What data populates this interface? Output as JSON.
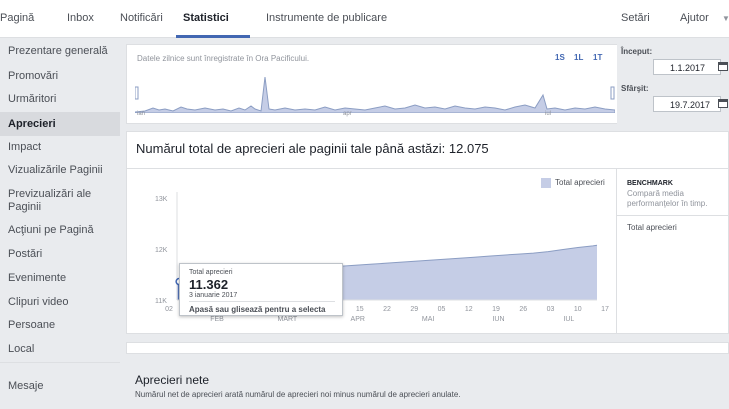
{
  "topnav": {
    "tabs": [
      "Pagină",
      "Inbox",
      "Notificări",
      "Statistici",
      "Instrumente de publicare",
      "Setări",
      "Ajutor"
    ],
    "active_tab": "Statistici"
  },
  "sidebar": {
    "items": [
      {
        "label": "Prezentare generală"
      },
      {
        "label": "Promovări"
      },
      {
        "label": "Urmăritori"
      },
      {
        "label": "Aprecieri"
      },
      {
        "label": "Impact"
      },
      {
        "label": "Vizualizările Paginii"
      },
      {
        "label": "Previzualizări ale Paginii"
      },
      {
        "label": "Acţiuni pe Pagină"
      },
      {
        "label": "Postări"
      },
      {
        "label": "Evenimente"
      },
      {
        "label": "Clipuri video"
      },
      {
        "label": "Persoane"
      },
      {
        "label": "Local"
      },
      {
        "label": "Mesaje"
      }
    ],
    "active": "Aprecieri"
  },
  "timeline": {
    "note": "Datele zilnice sunt înregistrate în Ora Pacificului.",
    "ranges": [
      "1S",
      "1L",
      "1T"
    ],
    "months": [
      "ian",
      "apr",
      "iul"
    ]
  },
  "dates": {
    "start_label": "Început:",
    "start_value": "1.1.2017",
    "end_label": "Sfârşit:",
    "end_value": "19.7.2017"
  },
  "main": {
    "title": "Numărul total de aprecieri ale paginii tale până astăzi: 12.075"
  },
  "benchmark": {
    "title": "BENCHMARK",
    "subtitle": "Compară media performanţelor în timp.",
    "series": "Total aprecieri"
  },
  "tooltip": {
    "label": "Total aprecieri",
    "value": "11.362",
    "date": "3 ianuarie 2017",
    "hint": "Apasă sau glisează pentru a selecta"
  },
  "net": {
    "title": "Aprecieri nete",
    "description": "Numărul net de aprecieri arată numărul de aprecieri noi minus numărul de aprecieri anulate."
  },
  "colors": {
    "accent": "#4267b2",
    "area_fill": "#c5cde6",
    "area_line": "#8b9dc3"
  },
  "chart_data": {
    "type": "area",
    "title": "",
    "legend": [
      "Total aprecieri"
    ],
    "legend_position": "top-right",
    "y_ticks": [
      "11K",
      "12K",
      "13K"
    ],
    "ylim": [
      11000,
      13000
    ],
    "x_day_ticks": [
      "02",
      "27",
      "03",
      "10",
      "17",
      "24",
      "08",
      "15",
      "22",
      "29",
      "05",
      "12",
      "19",
      "26",
      "03",
      "10",
      "17"
    ],
    "x_month_ticks": [
      "FEB",
      "MART",
      "APR",
      "MAI",
      "IUN",
      "IUL"
    ],
    "series": [
      {
        "name": "Total aprecieri",
        "x": [
          "2017-01-02",
          "2017-01-03",
          "2017-01-09",
          "2017-01-16",
          "2017-01-23",
          "2017-01-30",
          "2017-02-06",
          "2017-02-13",
          "2017-02-20",
          "2017-02-27",
          "2017-03-06",
          "2017-03-13",
          "2017-03-20",
          "2017-03-27",
          "2017-04-03",
          "2017-04-10",
          "2017-04-17",
          "2017-04-24",
          "2017-05-01",
          "2017-05-08",
          "2017-05-15",
          "2017-05-22",
          "2017-05-29",
          "2017-06-05",
          "2017-06-12",
          "2017-06-19",
          "2017-06-26",
          "2017-07-03",
          "2017-07-10",
          "2017-07-17",
          "2017-07-19"
        ],
        "values": [
          11350,
          11362,
          11410,
          11440,
          11470,
          11500,
          11520,
          11545,
          11570,
          11595,
          11620,
          11640,
          11660,
          11680,
          11700,
          11720,
          11740,
          11760,
          11780,
          11800,
          11820,
          11840,
          11860,
          11880,
          11900,
          11920,
          11950,
          11990,
          12030,
          12060,
          12075
        ]
      }
    ],
    "grid": false
  }
}
